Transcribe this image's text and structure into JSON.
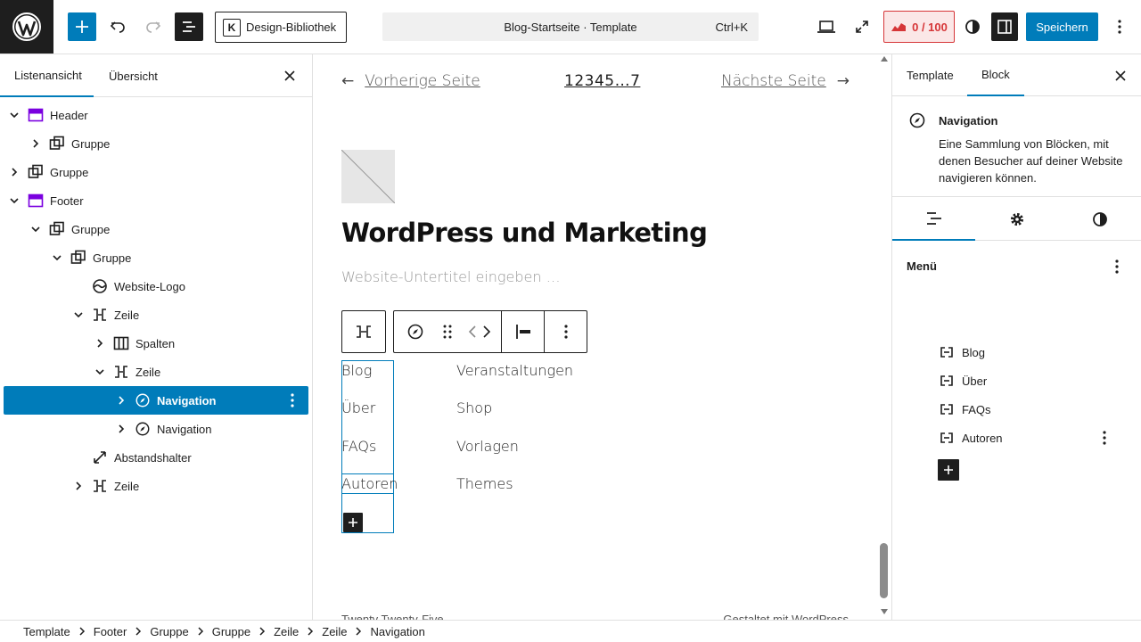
{
  "topbar": {
    "design_library_label": "Design-Bibliothek",
    "document_title": "Blog-Startseite · Template",
    "shortcut": "Ctrl+K",
    "score_label": "0 / 100",
    "save_label": "Speichern"
  },
  "left_panel": {
    "tab_list": "Listenansicht",
    "tab_overview": "Übersicht",
    "tree": [
      {
        "label": "Header",
        "level": 0,
        "chevron": "down",
        "icon": "template-part"
      },
      {
        "label": "Gruppe",
        "level": 1,
        "chevron": "right",
        "icon": "group"
      },
      {
        "label": "Gruppe",
        "level": 0,
        "chevron": "right",
        "icon": "group"
      },
      {
        "label": "Footer",
        "level": 0,
        "chevron": "down",
        "icon": "template-part"
      },
      {
        "label": "Gruppe",
        "level": 1,
        "chevron": "down",
        "icon": "group"
      },
      {
        "label": "Gruppe",
        "level": 2,
        "chevron": "down",
        "icon": "group"
      },
      {
        "label": "Website-Logo",
        "level": 3,
        "chevron": "none",
        "icon": "site-logo"
      },
      {
        "label": "Zeile",
        "level": 3,
        "chevron": "down",
        "icon": "row"
      },
      {
        "label": "Spalten",
        "level": 4,
        "chevron": "right",
        "icon": "columns"
      },
      {
        "label": "Zeile",
        "level": 4,
        "chevron": "down",
        "icon": "row"
      },
      {
        "label": "Navigation",
        "level": 5,
        "chevron": "right",
        "icon": "navigation",
        "selected": true
      },
      {
        "label": "Navigation",
        "level": 5,
        "chevron": "right",
        "icon": "navigation"
      },
      {
        "label": "Abstandshalter",
        "level": 3,
        "chevron": "none",
        "icon": "spacer"
      },
      {
        "label": "Zeile",
        "level": 3,
        "chevron": "right",
        "icon": "row"
      }
    ]
  },
  "canvas": {
    "pager": {
      "prev": "Vorherige Seite",
      "numbers": "12345…7",
      "next": "Nächste Seite"
    },
    "site_title": "WordPress und Marketing",
    "tagline_placeholder": "Website-Untertitel eingeben …",
    "nav1": [
      "Blog",
      "Über",
      "FAQs",
      "Autoren"
    ],
    "nav2": [
      "Veranstaltungen",
      "Shop",
      "Vorlagen",
      "Themes"
    ],
    "footer_left": "Twenty Twenty-Five",
    "footer_right": "Gestaltet mit WordPress"
  },
  "right_panel": {
    "tab_template": "Template",
    "tab_block": "Block",
    "block_title": "Navigation",
    "block_desc": "Eine Sammlung von Blöcken, mit denen Besucher auf deiner Website navigieren können.",
    "menu_heading": "Menü",
    "menu_items": [
      "Blog",
      "Über",
      "FAQs",
      "Autoren"
    ]
  },
  "breadcrumb": [
    "Template",
    "Footer",
    "Gruppe",
    "Gruppe",
    "Zeile",
    "Zeile",
    "Navigation"
  ],
  "colors": {
    "accent": "#007cba",
    "dark": "#1e1e1e",
    "template_part": "#7a00df",
    "score_red": "#d63638"
  }
}
